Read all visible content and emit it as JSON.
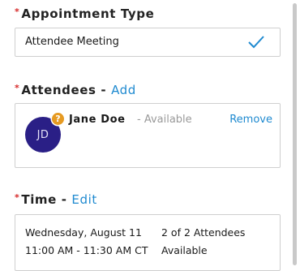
{
  "appointment_type": {
    "required_mark": "*",
    "label": "Appointment Type",
    "value": "Attendee Meeting"
  },
  "attendees": {
    "required_mark": "*",
    "label": "Attendees",
    "separator": "-",
    "add_link": "Add",
    "items": [
      {
        "initials": "JD",
        "badge": "?",
        "name": "Jane Doe",
        "status": "- Available",
        "remove_link": "Remove"
      }
    ]
  },
  "time": {
    "required_mark": "*",
    "label": "Time",
    "separator": "-",
    "edit_link": "Edit",
    "date": "Wednesday, August 11",
    "range": "11:00 AM - 11:30 AM CT",
    "attendee_count": "2 of 2 Attendees",
    "availability": "Available"
  },
  "colors": {
    "accent": "#1f8ad0",
    "required": "#d62828",
    "avatar_bg": "#2a1f86",
    "badge_bg": "#e69a22"
  },
  "icons": [
    "checkmark-icon",
    "question-badge-icon"
  ]
}
